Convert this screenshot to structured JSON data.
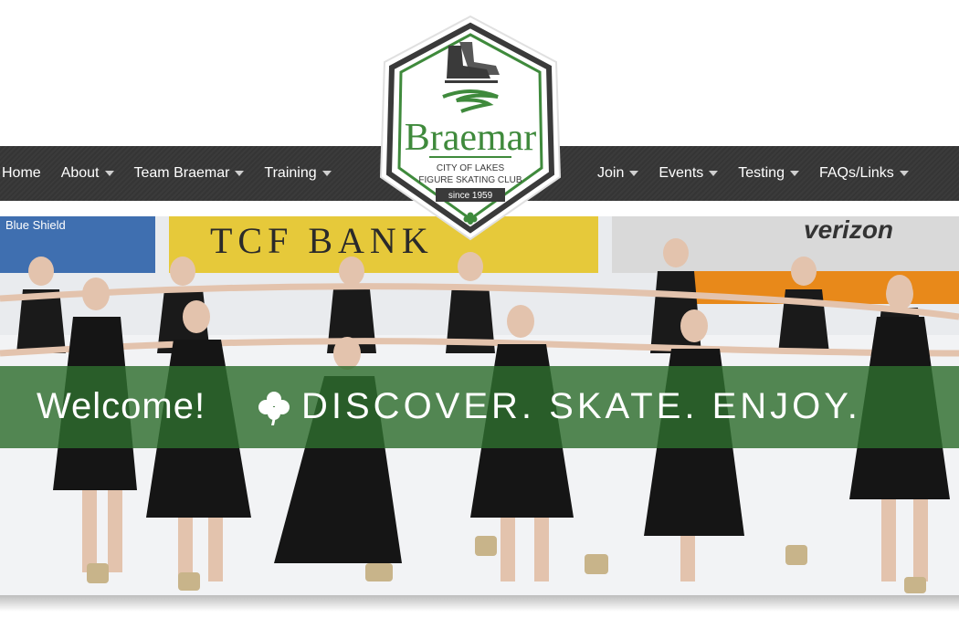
{
  "nav": {
    "left": [
      {
        "label": "Home",
        "has_dropdown": false
      },
      {
        "label": "About",
        "has_dropdown": true
      },
      {
        "label": "Team Braemar",
        "has_dropdown": true
      },
      {
        "label": "Training",
        "has_dropdown": true
      }
    ],
    "right": [
      {
        "label": "Join",
        "has_dropdown": true
      },
      {
        "label": "Events",
        "has_dropdown": true
      },
      {
        "label": "Testing",
        "has_dropdown": true
      },
      {
        "label": "FAQs/Links",
        "has_dropdown": true
      }
    ]
  },
  "logo": {
    "name": "Braemar",
    "line1": "CITY OF LAKES",
    "line2": "FIGURE SKATING CLUB",
    "since": "since 1959",
    "icons": [
      "skate-icon",
      "swirl-icon",
      "clover-icon"
    ]
  },
  "hero": {
    "welcome": "Welcome!",
    "tagline": "DISCOVER. SKATE. ENJOY.",
    "banner_color": "#2e6e2e",
    "background_signs": [
      "Blue Shield",
      "TCF BANK",
      "verizon"
    ]
  },
  "colors": {
    "brand_green": "#3f8a3c",
    "nav_bg": "#383838",
    "logo_border": "#3a3a3a"
  }
}
